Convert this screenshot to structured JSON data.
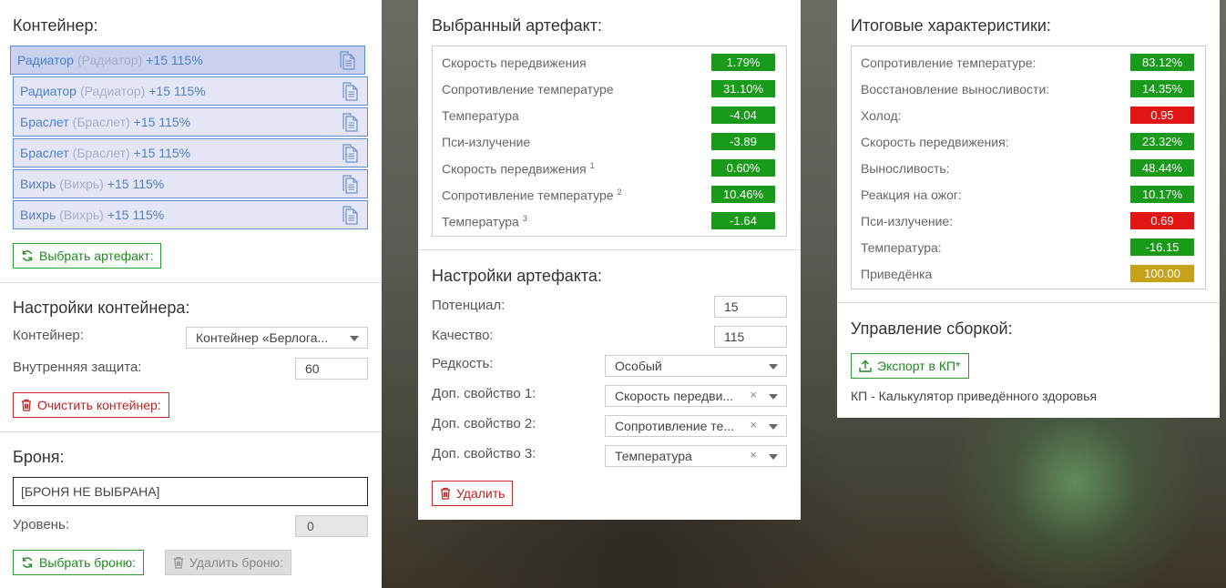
{
  "left": {
    "container_title": "Контейнер:",
    "items": [
      {
        "name": "Радиатор",
        "paren": "(Радиатор)",
        "level": "+15 115%",
        "selected": true
      },
      {
        "name": "Радиатор",
        "paren": "(Радиатор)",
        "level": "+15 115%",
        "selected": false
      },
      {
        "name": "Браслет",
        "paren": "(Браслет)",
        "level": "+15 115%",
        "selected": false
      },
      {
        "name": "Браслет",
        "paren": "(Браслет)",
        "level": "+15 115%",
        "selected": false
      },
      {
        "name": "Вихрь",
        "paren": "(Вихрь)",
        "level": "+15 115%",
        "selected": false
      },
      {
        "name": "Вихрь",
        "paren": "(Вихрь)",
        "level": "+15 115%",
        "selected": false
      }
    ],
    "choose_artifact_label": "Выбрать артефакт:",
    "container_settings_title": "Настройки контейнера:",
    "container_label": "Контейнер:",
    "container_value": "Контейнер «Берлога...",
    "inner_protection_label": "Внутренняя защита:",
    "inner_protection_value": "60",
    "clear_container_label": "Очистить контейнер:",
    "armor_title": "Броня:",
    "armor_value": "[БРОНЯ НЕ ВЫБРАНА]",
    "level_label": "Уровень:",
    "level_value": "0",
    "choose_armor_label": "Выбрать броню:",
    "delete_armor_label": "Удалить броню:"
  },
  "middle": {
    "selected_title": "Выбранный артефакт:",
    "stats": [
      {
        "name": "Скорость передвижения",
        "sup": "",
        "value": "1.79%",
        "color": "green"
      },
      {
        "name": "Сопротивление температуре",
        "sup": "",
        "value": "31.10%",
        "color": "green"
      },
      {
        "name": "Температура",
        "sup": "",
        "value": "-4.04",
        "color": "green"
      },
      {
        "name": "Пси-излучение",
        "sup": "",
        "value": "-3.89",
        "color": "green"
      },
      {
        "name": "Скорость передвижения",
        "sup": "1",
        "value": "0.60%",
        "color": "green"
      },
      {
        "name": "Сопротивление температуре",
        "sup": "2",
        "value": "10.46%",
        "color": "green"
      },
      {
        "name": "Температура",
        "sup": "3",
        "value": "-1.64",
        "color": "green"
      }
    ],
    "settings_title": "Настройки артефакта:",
    "potential_label": "Потенциал:",
    "potential_value": "15",
    "quality_label": "Качество:",
    "quality_value": "115",
    "rarity_label": "Редкость:",
    "rarity_value": "Особый",
    "prop1_label": "Доп. свойство 1:",
    "prop1_value": "Скорость передви...",
    "prop2_label": "Доп. свойство 2:",
    "prop2_value": "Сопротивление те...",
    "prop3_label": "Доп. свойство 3:",
    "prop3_value": "Температура",
    "clear_symbol": "×",
    "delete_label": "Удалить"
  },
  "right": {
    "totals_title": "Итоговые характеристики:",
    "stats": [
      {
        "name": "Сопротивление температуре:",
        "value": "83.12%",
        "color": "green"
      },
      {
        "name": "Восстановление выносливости:",
        "value": "14.35%",
        "color": "green"
      },
      {
        "name": "Холод:",
        "value": "0.95",
        "color": "red"
      },
      {
        "name": "Скорость передвижения:",
        "value": "23.32%",
        "color": "green"
      },
      {
        "name": "Выносливость:",
        "value": "48.44%",
        "color": "green"
      },
      {
        "name": "Реакция на ожог:",
        "value": "10.17%",
        "color": "green"
      },
      {
        "name": "Пси-излучение:",
        "value": "0.69",
        "color": "red"
      },
      {
        "name": "Температура:",
        "value": "-16.15",
        "color": "green"
      },
      {
        "name": "Приведёнка",
        "value": "100.00",
        "color": "gold"
      }
    ],
    "build_title": "Управление сборкой:",
    "export_label": "Экспорт в КП*",
    "footnote": "КП - Калькулятор приведённого здоровья"
  },
  "colors": {
    "green": "#1a9a1a",
    "red": "#e21414",
    "gold": "#c8a11a",
    "link_blue": "#4f80cf"
  }
}
